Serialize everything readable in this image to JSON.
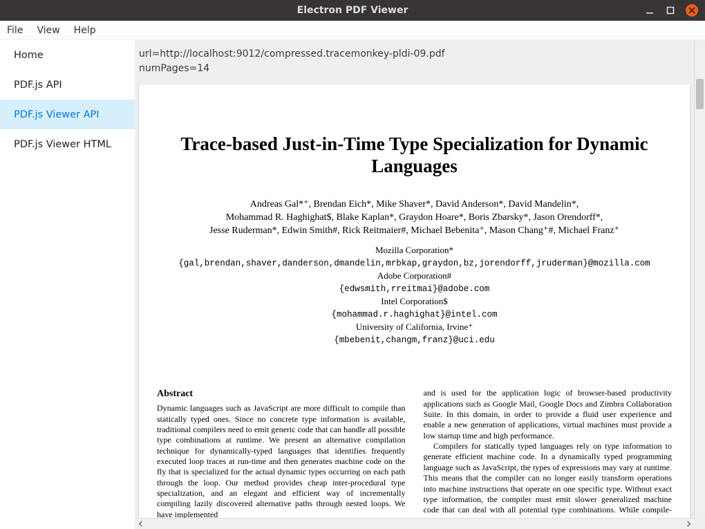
{
  "window": {
    "title": "Electron PDF Viewer"
  },
  "menu": {
    "items": [
      "File",
      "View",
      "Help"
    ]
  },
  "sidebar": {
    "items": [
      {
        "label": "Home",
        "active": false
      },
      {
        "label": "PDF.js API",
        "active": false
      },
      {
        "label": "PDF.js Viewer API",
        "active": true
      },
      {
        "label": "PDF.js Viewer HTML",
        "active": false
      }
    ]
  },
  "info": {
    "url_line": "url=http://localhost:9012/compressed.tracemonkey-pldi-09.pdf",
    "numpages_line": "numPages=14"
  },
  "paper": {
    "title": "Trace-based Just-in-Time Type Specialization for Dynamic Languages",
    "authors_line1": "Andreas Gal*⁺, Brendan Eich*, Mike Shaver*, David Anderson*, David Mandelin*,",
    "authors_line2": "Mohammad R. Haghighat$, Blake Kaplan*, Graydon Hoare*, Boris Zbarsky*, Jason Orendorff*,",
    "authors_line3": "Jesse Ruderman*, Edwin Smith#, Rick Reitmaier#, Michael Bebenita⁺, Mason Chang⁺#, Michael Franz⁺",
    "aff1_org": "Mozilla Corporation*",
    "aff1_mail": "{gal,brendan,shaver,danderson,dmandelin,mrbkap,graydon,bz,jorendorff,jruderman}@mozilla.com",
    "aff2_org": "Adobe Corporation#",
    "aff2_mail": "{edwsmith,rreitmai}@adobe.com",
    "aff3_org": "Intel Corporation$",
    "aff3_mail": "{mohammad.r.haghighat}@intel.com",
    "aff4_org": "University of California, Irvine⁺",
    "aff4_mail": "{mbebenit,changm,franz}@uci.edu",
    "abstract_heading": "Abstract",
    "abstract_body": "Dynamic languages such as JavaScript are more difficult to compile than statically typed ones. Since no concrete type information is available, traditional compilers need to emit generic code that can handle all possible type combinations at runtime. We present an alternative compilation technique for dynamically-typed languages that identifies frequently executed loop traces at run-time and then generates machine code on the fly that is specialized for the actual dynamic types occurring on each path through the loop. Our method provides cheap inter-procedural type specialization, and an elegant and efficient way of incrementally compiling lazily discovered alternative paths through nested loops. We have implemented",
    "col2_p1": "and is used for the application logic of browser-based productivity applications such as Google Mail, Google Docs and Zimbra Collaboration Suite. In this domain, in order to provide a fluid user experience and enable a new generation of applications, virtual machines must provide a low startup time and high performance.",
    "col2_p2": "Compilers for statically typed languages rely on type information to generate efficient machine code. In a dynamically typed programming language such as JavaScript, the types of expressions may vary at runtime. This means that the compiler can no longer easily transform operations into machine instructions that operate on one specific type. Without exact type information, the compiler must emit slower generalized machine code that can deal with all potential type combinations. While compile-time static type infer-"
  }
}
